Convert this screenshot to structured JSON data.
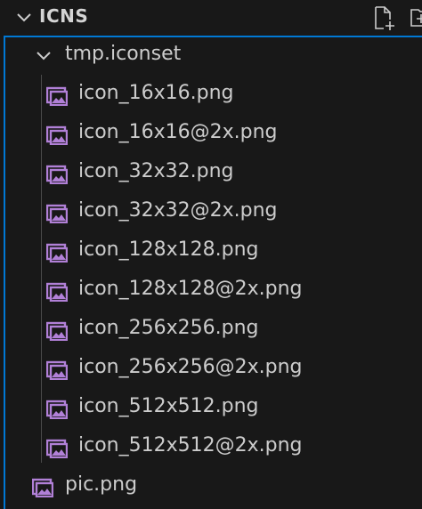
{
  "explorer": {
    "section_title": "ICNS",
    "folder": {
      "name": "tmp.iconset",
      "files": [
        "icon_16x16.png",
        "icon_16x16@2x.png",
        "icon_32x32.png",
        "icon_32x32@2x.png",
        "icon_128x128.png",
        "icon_128x128@2x.png",
        "icon_256x256.png",
        "icon_256x256@2x.png",
        "icon_512x512.png",
        "icon_512x512@2x.png"
      ]
    },
    "root_files": [
      "pic.png"
    ],
    "icons": {
      "section_toggle": "chevron-down-icon",
      "folder_toggle": "chevron-down-icon",
      "file": "image-file-icon",
      "actions": [
        "new-file-icon",
        "new-folder-icon"
      ]
    },
    "colors": {
      "background": "#181818",
      "focus_border": "#0078d4",
      "image_icon": "#b180d7",
      "text": "#cccccc"
    }
  }
}
